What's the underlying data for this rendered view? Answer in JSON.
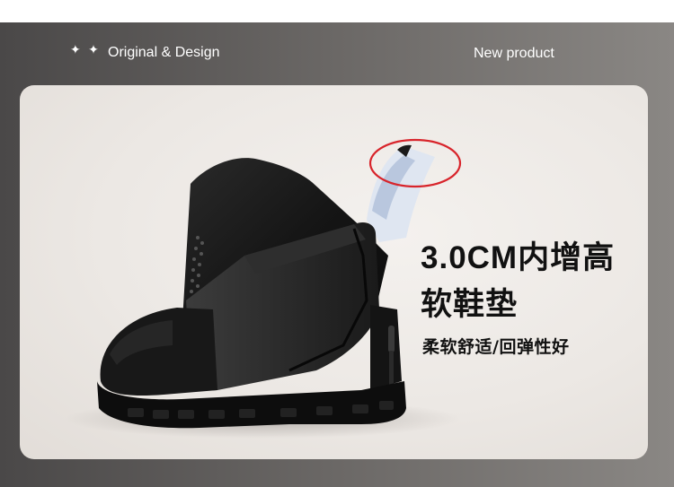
{
  "header": {
    "sparkles": "✦ ✦",
    "brand_label": "Original & Design",
    "new_product_label": "New product"
  },
  "feature": {
    "headline_line1": "3.0CM内增高",
    "headline_line2": "软鞋垫",
    "subtext": "柔软舒适/回弹性好"
  },
  "colors": {
    "banner": "#5a5856",
    "card": "#ece8e4",
    "highlight_circle": "#d8242b",
    "text_dark": "#111111",
    "text_light": "#ffffff"
  }
}
